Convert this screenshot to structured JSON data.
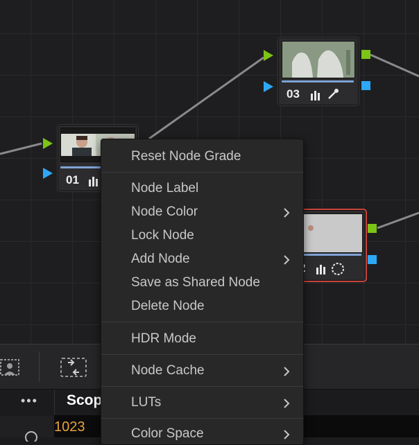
{
  "nodes": [
    {
      "id": "01",
      "number": "01"
    },
    {
      "id": "02",
      "number": "2"
    },
    {
      "id": "03",
      "number": "03"
    }
  ],
  "menu": {
    "items": [
      {
        "label": "Reset Node Grade",
        "submenu": false
      },
      {
        "label": "Node Label",
        "submenu": false
      },
      {
        "label": "Node Color",
        "submenu": true
      },
      {
        "label": "Lock Node",
        "submenu": false
      },
      {
        "label": "Add Node",
        "submenu": true
      },
      {
        "label": "Save as Shared Node",
        "submenu": false
      },
      {
        "label": "Delete Node",
        "submenu": false
      },
      {
        "label": "HDR Mode",
        "submenu": false
      },
      {
        "label": "Node Cache",
        "submenu": true
      },
      {
        "label": "LUTs",
        "submenu": true
      },
      {
        "label": "Color Space",
        "submenu": true
      }
    ]
  },
  "bottom_panel": {
    "more_label": "•••",
    "tab_label": "Scop",
    "timecode": "1023"
  },
  "colors": {
    "rgb_output_port": "#7cc416",
    "rgb_input_port": "#7cc416",
    "key_port": "#2ea8f5",
    "selected_border": "#c8453d",
    "timecode": "#e8a33a"
  },
  "icons": {
    "histogram": "histogram-icon",
    "eyedropper": "eyedropper-icon",
    "window": "circle-window-icon",
    "chevron": "chevron-right-icon"
  }
}
